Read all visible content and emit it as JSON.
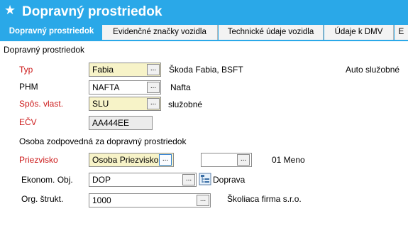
{
  "window": {
    "title": "Dopravný prostriedok",
    "star_glyph": "★"
  },
  "tabs": [
    {
      "label": "Dopravný prostriedok",
      "active": true
    },
    {
      "label": "Evidenčné značky vozidla",
      "active": false
    },
    {
      "label": "Technické údaje vozidla",
      "active": false
    },
    {
      "label": "Údaje k DMV",
      "active": false
    },
    {
      "label": "E",
      "active": false
    }
  ],
  "section": {
    "title": "Dopravný prostriedok"
  },
  "form": {
    "typ": {
      "label": "Typ",
      "value": "Fabia",
      "description": "Škoda Fabia, BSFT",
      "extra": "Auto služobné"
    },
    "phm": {
      "label": "PHM",
      "value": "NAFTA",
      "description": "Nafta"
    },
    "spos_vlast": {
      "label": "Spôs. vlast.",
      "value": "SLU",
      "description": "služobné"
    },
    "ecv": {
      "label": "EČV",
      "value": "AA444EE"
    },
    "responsible_heading": "Osoba zodpovedná za dopravný prostriedok",
    "priezvisko": {
      "label": "Priezvisko",
      "value": "Osoba Priezvisko",
      "meno_value": "",
      "meno_description": "01 Meno"
    },
    "ekonom_obj": {
      "label": "Ekonom. Obj.",
      "value": "DOP",
      "description": "Doprava"
    },
    "org_strukt": {
      "label": "Org. štrukt.",
      "value": "1000",
      "description": "Školiaca firma  s.r.o."
    }
  },
  "ui": {
    "ellipsis": "...",
    "icons": {
      "star": "star-icon",
      "tree": "org-tree-icon"
    }
  },
  "colors": {
    "accent": "#2aa8e8",
    "required_label": "#cc1a1a",
    "yellow_field": "#f7f3c8"
  }
}
